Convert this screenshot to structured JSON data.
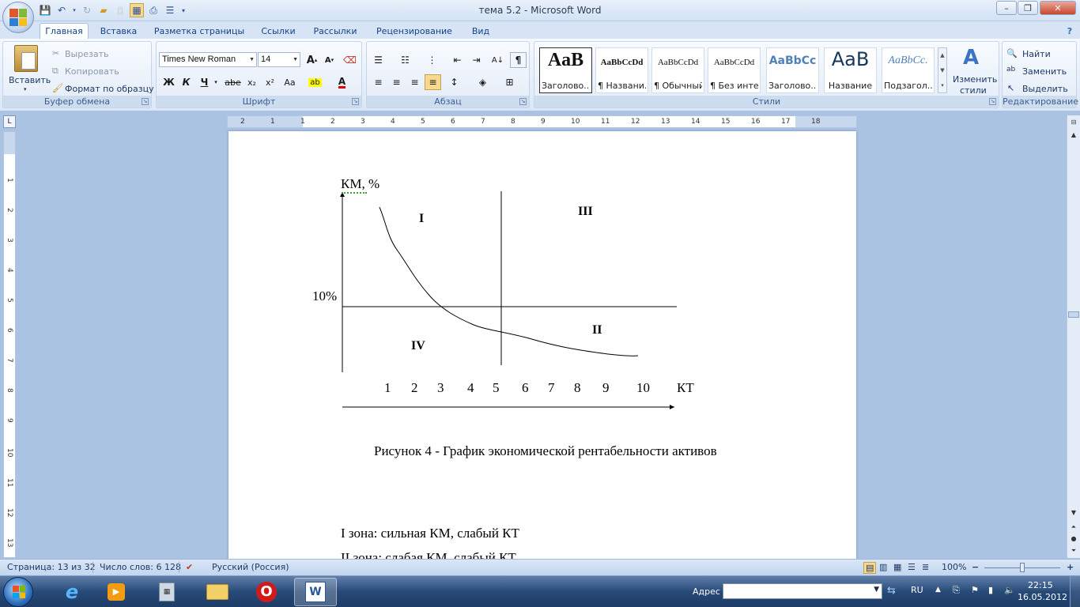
{
  "window": {
    "title": "тема 5.2 - Microsoft Word",
    "minimize": "–",
    "maximize": "❐",
    "close": "✕"
  },
  "tabs": [
    "Главная",
    "Вставка",
    "Разметка страницы",
    "Ссылки",
    "Рассылки",
    "Рецензирование",
    "Вид"
  ],
  "ribbon": {
    "clipboard": {
      "paste": "Вставить",
      "cut": "Вырезать",
      "copy": "Копировать",
      "format_painter": "Формат по образцу",
      "label": "Буфер обмена"
    },
    "font": {
      "name": "Times New Roman",
      "size": "14",
      "label": "Шрифт",
      "bold": "Ж",
      "italic": "К",
      "underline": "Ч",
      "strike": "abe",
      "subscript": "x₂",
      "superscript": "x²",
      "case": "Aa",
      "grow": "A",
      "shrink": "A"
    },
    "paragraph": {
      "label": "Абзац",
      "pilcrow": "¶"
    },
    "styles": {
      "label": "Стили",
      "items": [
        {
          "sample": "AaB",
          "name": "Заголово..."
        },
        {
          "sample": "AaBbCcDd",
          "name": "¶ Названи..."
        },
        {
          "sample": "AaBbCcDd",
          "name": "¶ Обычный"
        },
        {
          "sample": "AaBbCcDd",
          "name": "¶ Без инте..."
        },
        {
          "sample": "AaBbCc",
          "name": "Заголово..."
        },
        {
          "sample": "AaB",
          "name": "Название"
        },
        {
          "sample": "AaBbCc.",
          "name": "Подзагол..."
        }
      ],
      "change_styles_line1": "Изменить",
      "change_styles_line2": "стили"
    },
    "editing": {
      "label": "Редактирование",
      "find": "Найти",
      "replace": "Заменить",
      "select": "Выделить"
    }
  },
  "ruler": {
    "corner": "L",
    "h_ticks": [
      "2",
      "1",
      "1",
      "2",
      "3",
      "4",
      "5",
      "6",
      "7",
      "8",
      "9",
      "10",
      "11",
      "12",
      "13",
      "14",
      "15",
      "16",
      "17",
      "18"
    ],
    "v_ticks": [
      "1",
      "2",
      "3",
      "4",
      "5",
      "6",
      "7",
      "8",
      "9",
      "10",
      "11",
      "12",
      "13"
    ]
  },
  "document": {
    "figure": {
      "y_axis_label": "КМ, %",
      "y_mark": "10%",
      "x_axis_label": "КТ",
      "x_ticks": [
        "1",
        "2",
        "3",
        "4",
        "5",
        "6",
        "7",
        "8",
        "9",
        "10"
      ],
      "zones": {
        "z1": "I",
        "z2": "II",
        "z3": "III",
        "z4": "IV"
      },
      "caption": "Рисунок 4 - График экономической рентабельности активов"
    },
    "lines": [
      "I зона: сильная КМ, слабый КТ",
      "II зона: слабая КМ, слабый КТ"
    ]
  },
  "status": {
    "page": "Страница: 13 из 32",
    "words": "Число слов: 6 128",
    "language": "Русский (Россия)",
    "zoom": "100%",
    "zoom_minus": "−",
    "zoom_plus": "+"
  },
  "taskbar": {
    "address_label": "Адрес",
    "lang": "RU",
    "time": "22:15",
    "date": "16.05.2012"
  },
  "colors": {
    "accent": "#15428b",
    "ribbon": "#dbe7f6",
    "taskbar": "#284a78"
  }
}
